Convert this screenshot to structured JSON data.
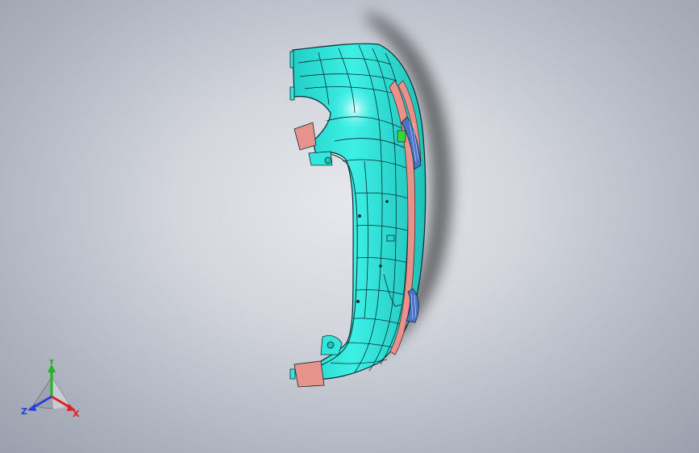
{
  "viewport": {
    "background_top": "#e6e8ed",
    "background_edge": "#9aa0ad"
  },
  "model": {
    "name": "bumper-model",
    "colors": {
      "body": "#35e6dc",
      "body_dark": "#20c4bc",
      "highlight": "#c9fbf8",
      "trim": "#e7938c",
      "edge": "#0b2b2e",
      "accent": "#35d63a",
      "grille": "#4b74c9"
    }
  },
  "triad": {
    "labels": {
      "y": "Y",
      "x": "X",
      "z": "Z"
    },
    "colors": {
      "y": "#22b322",
      "x": "#e02020",
      "z": "#2a3fd8"
    }
  }
}
